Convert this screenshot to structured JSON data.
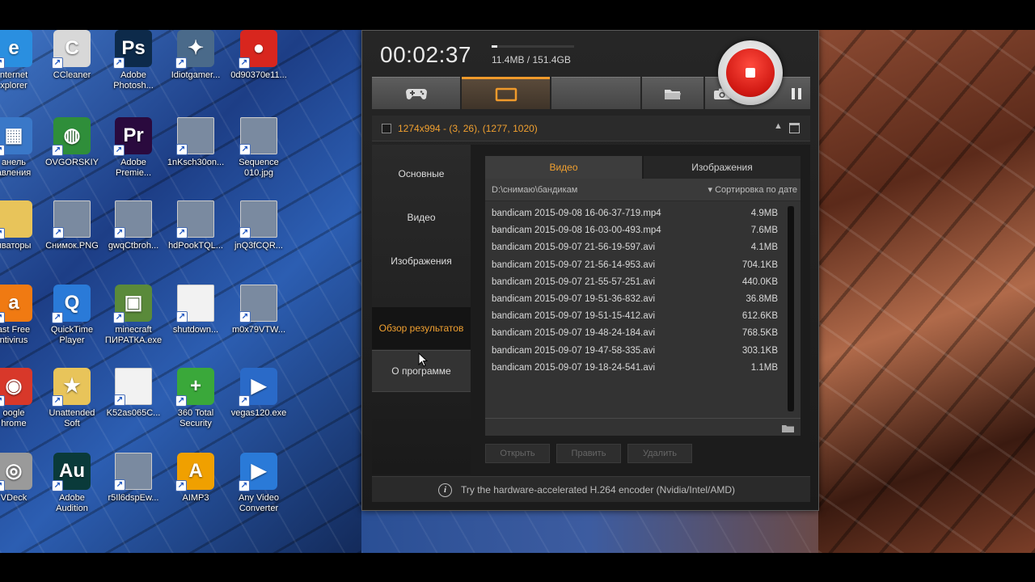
{
  "desktop": {
    "icons": [
      {
        "label": "nternet\nxplorer",
        "icon": "internet-explorer-icon"
      },
      {
        "label": "CCleaner",
        "icon": "ccleaner-icon"
      },
      {
        "label": "Adobe\nPhotosh...",
        "icon": "photoshop-icon"
      },
      {
        "label": "Idiotgamer...",
        "icon": "game-image-icon"
      },
      {
        "label": "0d90370e11...",
        "icon": "bandicam-shortcut-icon"
      },
      {
        "label": "анель\nавления",
        "icon": "control-panel-icon"
      },
      {
        "label": "OVGORSKIY",
        "icon": "network-globe-icon"
      },
      {
        "label": "Adobe\nPremie...",
        "icon": "premiere-icon"
      },
      {
        "label": "1nKsch30on...",
        "icon": "image-file-icon"
      },
      {
        "label": "Sequence\n010.jpg",
        "icon": "image-file-icon"
      },
      {
        "label": "иваторы",
        "icon": "folder-icon"
      },
      {
        "label": "Снимок.PNG",
        "icon": "image-file-icon"
      },
      {
        "label": "gwqCtbroh...",
        "icon": "image-file-icon"
      },
      {
        "label": "hdPookTQL...",
        "icon": "image-file-icon"
      },
      {
        "label": "jnQ3fCQR...",
        "icon": "image-file-icon"
      },
      {
        "label": "ast Free\nntivirus",
        "icon": "avast-icon"
      },
      {
        "label": "QuickTime\nPlayer",
        "icon": "quicktime-icon"
      },
      {
        "label": "minecraft\nПИРАТКА.exe",
        "icon": "minecraft-icon"
      },
      {
        "label": "shutdown...",
        "icon": "document-icon"
      },
      {
        "label": "m0x79VTW...",
        "icon": "image-file-icon"
      },
      {
        "label": "oogle\nhrome",
        "icon": "chrome-icon"
      },
      {
        "label": "Unattended\nSoft",
        "icon": "folder-star-icon"
      },
      {
        "label": "K52as065C...",
        "icon": "document-icon"
      },
      {
        "label": "360 Total\nSecurity",
        "icon": "360-security-icon"
      },
      {
        "label": "vegas120.exe",
        "icon": "vegas-icon"
      },
      {
        "label": "VDeck",
        "icon": "vdeck-icon"
      },
      {
        "label": "Adobe\nAudition",
        "icon": "audition-icon"
      },
      {
        "label": "r5Il6dspEw...",
        "icon": "image-file-icon"
      },
      {
        "label": "AIMP3",
        "icon": "aimp-icon"
      },
      {
        "label": "Any Video\nConverter",
        "icon": "video-converter-icon"
      }
    ]
  },
  "bandicam": {
    "timer": "00:02:37",
    "size_text": "11.4MB / 151.4GB",
    "size_progress": 0.07,
    "tabs": [
      {
        "name": "game-mode",
        "icon": "gamepad-icon"
      },
      {
        "name": "screen-mode",
        "icon": "screen-rectangle-icon"
      },
      {
        "name": "device-mode",
        "icon": "blank"
      },
      {
        "name": "open-folder",
        "icon": "folder-icon"
      },
      {
        "name": "screenshot",
        "icon": "camera-icon"
      }
    ],
    "region_text": "1274x994 - (3, 26), (1277, 1020)",
    "sidebar": [
      {
        "label": "Основные"
      },
      {
        "label": "Видео"
      },
      {
        "label": "Изображения"
      },
      {
        "label": "Обзор результатов"
      },
      {
        "label": "О программе"
      }
    ],
    "content_tabs": {
      "video": "Видео",
      "images": "Изображения"
    },
    "folder_path": "D:\\снимаю\\бандикам",
    "sort_label": "▾ Сортировка по дате",
    "files": [
      {
        "name": "bandicam 2015-09-08 16-06-37-719.mp4",
        "size": "4.9MB"
      },
      {
        "name": "bandicam 2015-09-08 16-03-00-493.mp4",
        "size": "7.6MB"
      },
      {
        "name": "bandicam 2015-09-07 21-56-19-597.avi",
        "size": "4.1MB"
      },
      {
        "name": "bandicam 2015-09-07 21-56-14-953.avi",
        "size": "704.1KB"
      },
      {
        "name": "bandicam 2015-09-07 21-55-57-251.avi",
        "size": "440.0KB"
      },
      {
        "name": "bandicam 2015-09-07 19-51-36-832.avi",
        "size": "36.8MB"
      },
      {
        "name": "bandicam 2015-09-07 19-51-15-412.avi",
        "size": "612.6KB"
      },
      {
        "name": "bandicam 2015-09-07 19-48-24-184.avi",
        "size": "768.5KB"
      },
      {
        "name": "bandicam 2015-09-07 19-47-58-335.avi",
        "size": "303.1KB"
      },
      {
        "name": "bandicam 2015-09-07 19-18-24-541.avi",
        "size": "1.1MB"
      }
    ],
    "buttons": {
      "open": "Открыть",
      "edit": "Править",
      "delete": "Удалить"
    },
    "status_text": "Try the hardware-accelerated H.264 encoder (Nvidia/Intel/AMD)",
    "colors": {
      "accent": "#f0a030",
      "record": "#d01812"
    }
  }
}
